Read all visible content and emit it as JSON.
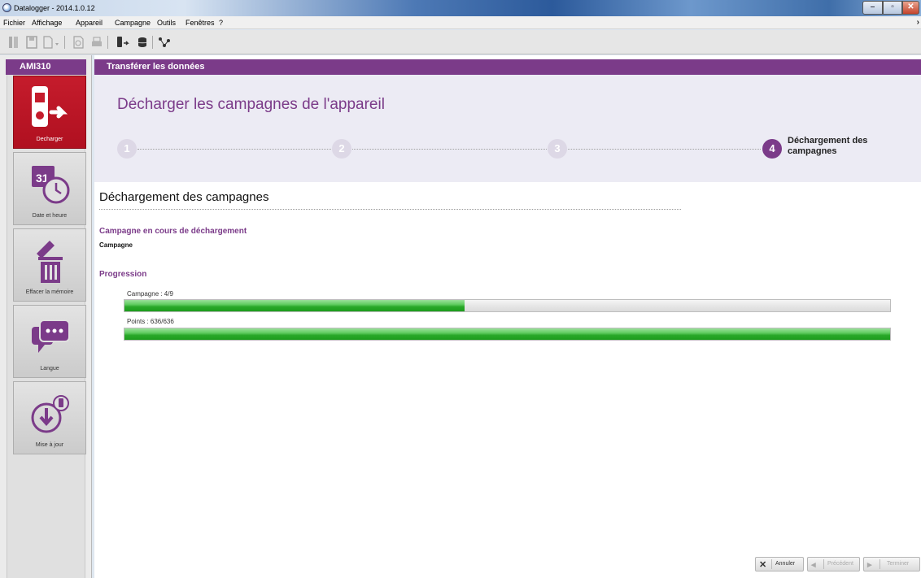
{
  "window": {
    "title": "Datalogger - 2014.1.0.12"
  },
  "menu": {
    "items": [
      "Fichier",
      "Affichage",
      "Appareil",
      "Campagne",
      "Outils",
      "Fenêtres",
      "?"
    ]
  },
  "toolbar": {
    "icons": [
      "open-icon",
      "save-icon",
      "export-icon",
      "preview-icon",
      "print-icon",
      "device-download-icon",
      "database-icon",
      "network-icon"
    ]
  },
  "sidebar": {
    "device": "AMI310",
    "items": [
      {
        "label": "Decharger",
        "icon": "device-download-icon",
        "active": true
      },
      {
        "label": "Date et heure",
        "icon": "calendar-clock-icon",
        "active": false
      },
      {
        "label": "Effacer la mémoire",
        "icon": "erase-trash-icon",
        "active": false
      },
      {
        "label": "Langue",
        "icon": "speech-bubble-icon",
        "active": false
      },
      {
        "label": "Mise à jour",
        "icon": "update-download-icon",
        "active": false
      }
    ]
  },
  "main": {
    "section_header": "Transférer les données",
    "page_title": "Décharger les campagnes de l'appareil",
    "steps": [
      "1",
      "2",
      "3",
      "4"
    ],
    "active_step_label": "Déchargement des campagnes",
    "content_title": "Déchargement des campagnes",
    "current_heading": "Campagne en cours de déchargement",
    "current_value": "Campagne",
    "progress_heading": "Progression",
    "progress": [
      {
        "label": "Campagne : 4/9",
        "fraction": 0.444
      },
      {
        "label": "Points : 636/636",
        "fraction": 1.0
      }
    ]
  },
  "footer": {
    "cancel": "Annuler",
    "previous": "Précédent",
    "finish": "Terminer"
  },
  "colors": {
    "accent": "#7b3b89",
    "active_tile": "#c51c2c",
    "progress": "#2eb52e"
  }
}
